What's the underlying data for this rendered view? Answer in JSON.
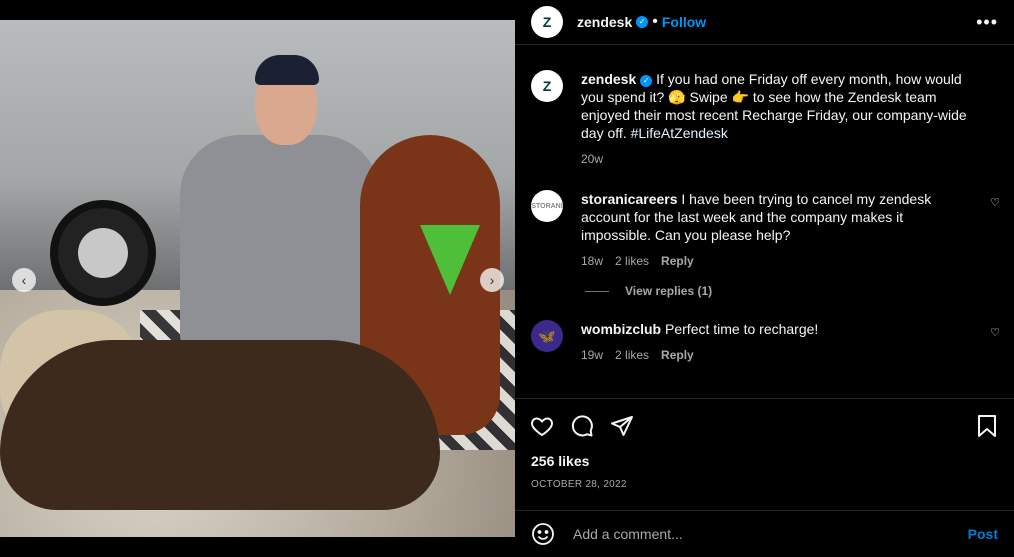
{
  "header": {
    "username": "zendesk",
    "avatar_text": "Z",
    "follow_label": "Follow",
    "more_label": "•••"
  },
  "caption": {
    "username": "zendesk",
    "avatar_text": "Z",
    "text_part1": "If you had one Friday off every month, how would you spend it? 🫣 Swipe 👉 to see how the Zendesk team enjoyed their most recent Recharge Friday, our company-wide day off. ",
    "hashtag": "#LifeAtZendesk",
    "age": "20w"
  },
  "comments": [
    {
      "username": "storanicareers",
      "avatar_text": "STORANI",
      "text": "I have been trying to cancel my zendesk account for the last week and the company makes it impossible. Can you please help?",
      "age": "18w",
      "likes": "2 likes",
      "reply_label": "Reply",
      "view_replies": "View replies (1)"
    },
    {
      "username": "wombizclub",
      "avatar_text": "🦋",
      "text": "Perfect time to recharge!",
      "age": "19w",
      "likes": "2 likes",
      "reply_label": "Reply"
    }
  ],
  "post": {
    "likes": "256 likes",
    "date": "OCTOBER 28, 2022"
  },
  "add_comment": {
    "placeholder": "Add a comment...",
    "post_label": "Post"
  },
  "carousel": {
    "prev": "‹",
    "next": "›"
  },
  "colors": {
    "accent": "#0095f6",
    "background": "#000000",
    "divider": "#262626",
    "muted": "#a8a8a8"
  },
  "icons": [
    "heart-icon",
    "comment-icon",
    "share-icon",
    "save-icon",
    "emoji-icon",
    "verified-icon",
    "more-icon"
  ]
}
